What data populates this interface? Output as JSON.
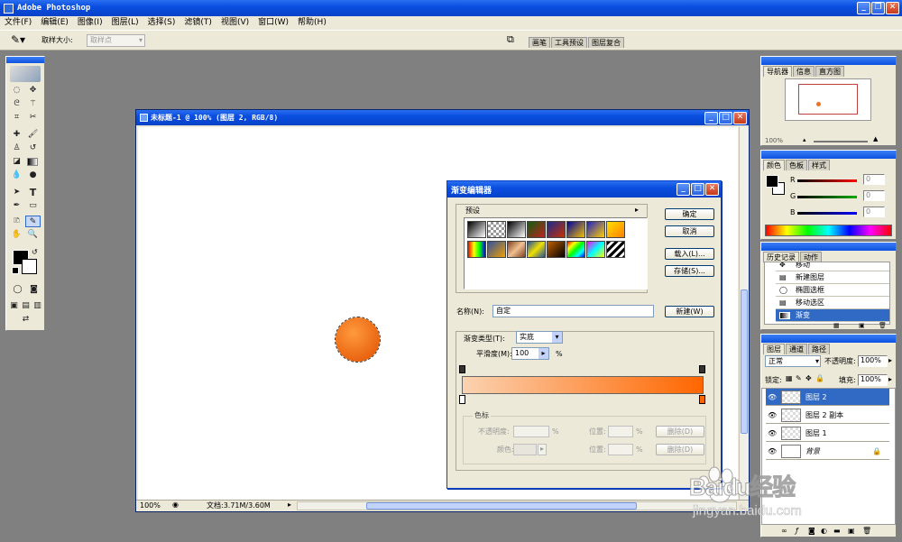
{
  "app": {
    "title": "Adobe Photoshop",
    "menu": [
      "文件(F)",
      "编辑(E)",
      "图像(I)",
      "图层(L)",
      "选择(S)",
      "滤镜(T)",
      "视图(V)",
      "窗口(W)",
      "帮助(H)"
    ]
  },
  "options_bar": {
    "sample_size_label": "取样大小:",
    "sample_size_value": "取样点",
    "well_tabs": [
      "画笔",
      "工具预设",
      "图层复合"
    ]
  },
  "document": {
    "title": "未标题-1 @ 100% (图层 2, RGB/8)",
    "zoom": "100%",
    "doc_info": "文档:3.71M/3.60M",
    "shape_colors": {
      "center": "#ff9a3c",
      "edge": "#e04e00"
    }
  },
  "gradient_editor": {
    "title": "渐变编辑器",
    "presets_label": "预设",
    "ok": "确定",
    "cancel": "取消",
    "load": "载入(L)...",
    "save": "存储(S)...",
    "name_label": "名称(N):",
    "name_value": "自定",
    "new_button": "新建(W)",
    "type_label": "渐变类型(T):",
    "type_value": "实底",
    "smooth_label": "平滑度(M):",
    "smooth_value": "100",
    "percent": "%",
    "gradient_colors": {
      "start": "#fbd2b0",
      "end": "#ff6600"
    },
    "stops_group": "色标",
    "opacity_label": "不透明度:",
    "color_label": "颜色:",
    "location_label": "位置:",
    "delete": "删除(D)"
  },
  "navigator": {
    "tabs": [
      "导航器",
      "信息",
      "直方图"
    ],
    "zoom": "100%"
  },
  "color_panel": {
    "tabs": [
      "颜色",
      "色板",
      "样式"
    ],
    "r_label": "R",
    "g_label": "G",
    "b_label": "B",
    "r_value": "0",
    "g_value": "0",
    "b_value": "0"
  },
  "history": {
    "tabs": [
      "历史记录",
      "动作"
    ],
    "items": [
      "移动",
      "新建图层",
      "椭圆选框",
      "移动选区",
      "渐变"
    ]
  },
  "layers": {
    "tabs": [
      "图层",
      "通道",
      "路径"
    ],
    "blend_mode": "正常",
    "opacity_label": "不透明度:",
    "opacity_value": "100%",
    "lock_label": "锁定:",
    "fill_label": "填充:",
    "fill_value": "100%",
    "items": [
      "图层 2",
      "图层 2 副本",
      "图层 1",
      "背景"
    ]
  },
  "watermark": {
    "brand": "Baidu经验",
    "url": "jingyan.baidu.com"
  }
}
